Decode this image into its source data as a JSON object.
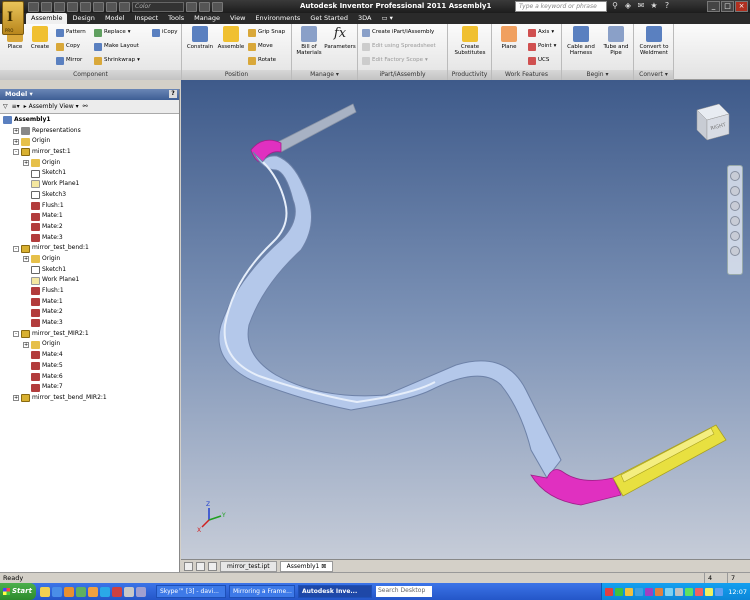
{
  "titlebar": {
    "app_title": "Autodesk Inventor Professional 2011   Assembly1",
    "search_placeholder": "Type a keyword or phrase",
    "color_combo": "Color",
    "logo_label": "PRO"
  },
  "ribbon_tabs": [
    "Assemble",
    "Design",
    "Model",
    "Inspect",
    "Tools",
    "Manage",
    "View",
    "Environments",
    "Get Started",
    "3DA"
  ],
  "ribbon": {
    "component": {
      "title": "Component",
      "place": "Place",
      "create": "Create",
      "pattern": "Pattern",
      "copy": "Copy",
      "mirror": "Mirror",
      "replace": "Replace",
      "make_layout": "Make Layout",
      "shrinkwrap": "Shrinkwrap",
      "icopy": "iCopy"
    },
    "position": {
      "title": "Position",
      "constrain": "Constrain",
      "assemble": "Assemble",
      "grip_snap": "Grip Snap",
      "move": "Move",
      "rotate": "Rotate"
    },
    "manage": {
      "title": "Manage",
      "bom": "Bill of Materials",
      "parameters": "Parameters"
    },
    "ipart": {
      "title": "iPart/iAssembly",
      "create": "Create iPart/iAssembly",
      "edit_spreadsheet": "Edit using Spreadsheet",
      "edit_factory": "Edit Factory Scope"
    },
    "productivity": {
      "title": "Productivity",
      "create_substitutes": "Create Substitutes"
    },
    "work_features": {
      "title": "Work Features",
      "plane": "Plane",
      "axis": "Axis",
      "point": "Point",
      "ucs": "UCS"
    },
    "begin": {
      "title": "Begin",
      "cable": "Cable and Harness",
      "tube": "Tube and Pipe"
    },
    "convert": {
      "title": "Convert",
      "weldment": "Convert to Weldment"
    }
  },
  "browser": {
    "title": "Model",
    "view_mode": "Assembly View",
    "help": "?",
    "tree": [
      {
        "label": "Assembly1",
        "indent": 0,
        "icon": "asm",
        "exp": ""
      },
      {
        "label": "Representations",
        "indent": 1,
        "icon": "repr",
        "exp": "+"
      },
      {
        "label": "Origin",
        "indent": 1,
        "icon": "origin",
        "exp": "+"
      },
      {
        "label": "mirror_test:1",
        "indent": 1,
        "icon": "part",
        "exp": "-"
      },
      {
        "label": "Origin",
        "indent": 2,
        "icon": "origin",
        "exp": "+"
      },
      {
        "label": "Sketch1",
        "indent": 2,
        "icon": "sketch",
        "exp": ""
      },
      {
        "label": "Work Plane1",
        "indent": 2,
        "icon": "plane",
        "exp": ""
      },
      {
        "label": "Sketch3",
        "indent": 2,
        "icon": "sketch",
        "exp": ""
      },
      {
        "label": "Flush:1",
        "indent": 2,
        "icon": "mate",
        "exp": ""
      },
      {
        "label": "Mate:1",
        "indent": 2,
        "icon": "mate",
        "exp": ""
      },
      {
        "label": "Mate:2",
        "indent": 2,
        "icon": "mate",
        "exp": ""
      },
      {
        "label": "Mate:3",
        "indent": 2,
        "icon": "mate",
        "exp": ""
      },
      {
        "label": "mirror_test_bend:1",
        "indent": 1,
        "icon": "part",
        "exp": "-"
      },
      {
        "label": "Origin",
        "indent": 2,
        "icon": "origin",
        "exp": "+"
      },
      {
        "label": "Sketch1",
        "indent": 2,
        "icon": "sketch",
        "exp": ""
      },
      {
        "label": "Work Plane1",
        "indent": 2,
        "icon": "plane",
        "exp": ""
      },
      {
        "label": "Flush:1",
        "indent": 2,
        "icon": "mate",
        "exp": ""
      },
      {
        "label": "Mate:1",
        "indent": 2,
        "icon": "mate",
        "exp": ""
      },
      {
        "label": "Mate:2",
        "indent": 2,
        "icon": "mate",
        "exp": ""
      },
      {
        "label": "Mate:3",
        "indent": 2,
        "icon": "mate",
        "exp": ""
      },
      {
        "label": "mirror_test_MIR2:1",
        "indent": 1,
        "icon": "part",
        "exp": "-"
      },
      {
        "label": "Origin",
        "indent": 2,
        "icon": "origin",
        "exp": "+"
      },
      {
        "label": "Mate:4",
        "indent": 2,
        "icon": "mate",
        "exp": ""
      },
      {
        "label": "Mate:5",
        "indent": 2,
        "icon": "mate",
        "exp": ""
      },
      {
        "label": "Mate:6",
        "indent": 2,
        "icon": "mate",
        "exp": ""
      },
      {
        "label": "Mate:7",
        "indent": 2,
        "icon": "mate",
        "exp": ""
      },
      {
        "label": "mirror_test_bend_MIR2:1",
        "indent": 1,
        "icon": "part",
        "exp": "+"
      }
    ]
  },
  "viewcube": {
    "face_label": "RIGHT"
  },
  "doc_tabs": [
    "mirror_test.ipt",
    "Assembly1"
  ],
  "status": {
    "text": "Ready",
    "num1": "4",
    "num2": "7"
  },
  "taskbar": {
    "start": "Start",
    "tasks": [
      "Skype™ [3] - davi...",
      "Mirroring a Frame...",
      "Autodesk Inve..."
    ],
    "search": "Search Desktop",
    "clock": "12:07"
  },
  "colors": {
    "pink": "#e030c0",
    "yellow": "#e8e040",
    "tube": "#b4c8ea"
  }
}
